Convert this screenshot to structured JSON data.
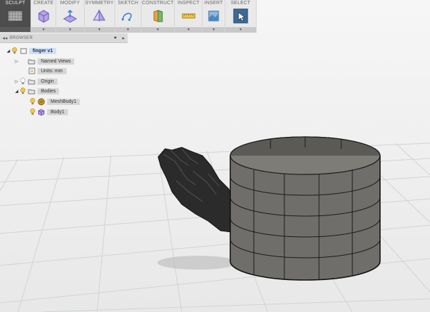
{
  "toolbar": {
    "groups": [
      {
        "label": "SCULPT",
        "icon": "sculpt-form-icon"
      },
      {
        "label": "CREATE",
        "icon": "create-box-icon"
      },
      {
        "label": "MODIFY",
        "icon": "modify-edit-form-icon"
      },
      {
        "label": "SYMMETRY",
        "icon": "symmetry-icon"
      },
      {
        "label": "SKETCH",
        "icon": "sketch-curve-icon"
      },
      {
        "label": "CONSTRUCT",
        "icon": "construct-plane-icon"
      },
      {
        "label": "INSPECT",
        "icon": "measure-icon"
      },
      {
        "label": "INSERT",
        "icon": "insert-canvas-icon"
      },
      {
        "label": "SELECT",
        "icon": "select-cursor-icon"
      }
    ],
    "dropdown_glyph": "▾"
  },
  "browser": {
    "title": "BROWSER",
    "collapse_glyph": "◂◂",
    "header_buttons": [
      "●",
      "▸"
    ],
    "root": {
      "label": "finger v1",
      "expanded_glyph": "◢"
    },
    "named_views": {
      "label": "Named Views",
      "collapsed_glyph": "▷"
    },
    "units": {
      "label": "Units: mm"
    },
    "origin": {
      "label": "Origin",
      "collapsed_glyph": "▷"
    },
    "bodies": {
      "label": "Bodies",
      "expanded_glyph": "◢"
    },
    "mesh_body": {
      "label": "MeshBody1"
    },
    "body1": {
      "label": "Body1"
    }
  },
  "viewport": {
    "objects": [
      "hand-mesh",
      "cylinder-form-body"
    ],
    "colors": {
      "background": "#efefef",
      "grid": "#cfd2d6",
      "cylinder": "#6f6e6a",
      "edges": "#1a1a1a",
      "hand": "#2a2a2a"
    }
  }
}
